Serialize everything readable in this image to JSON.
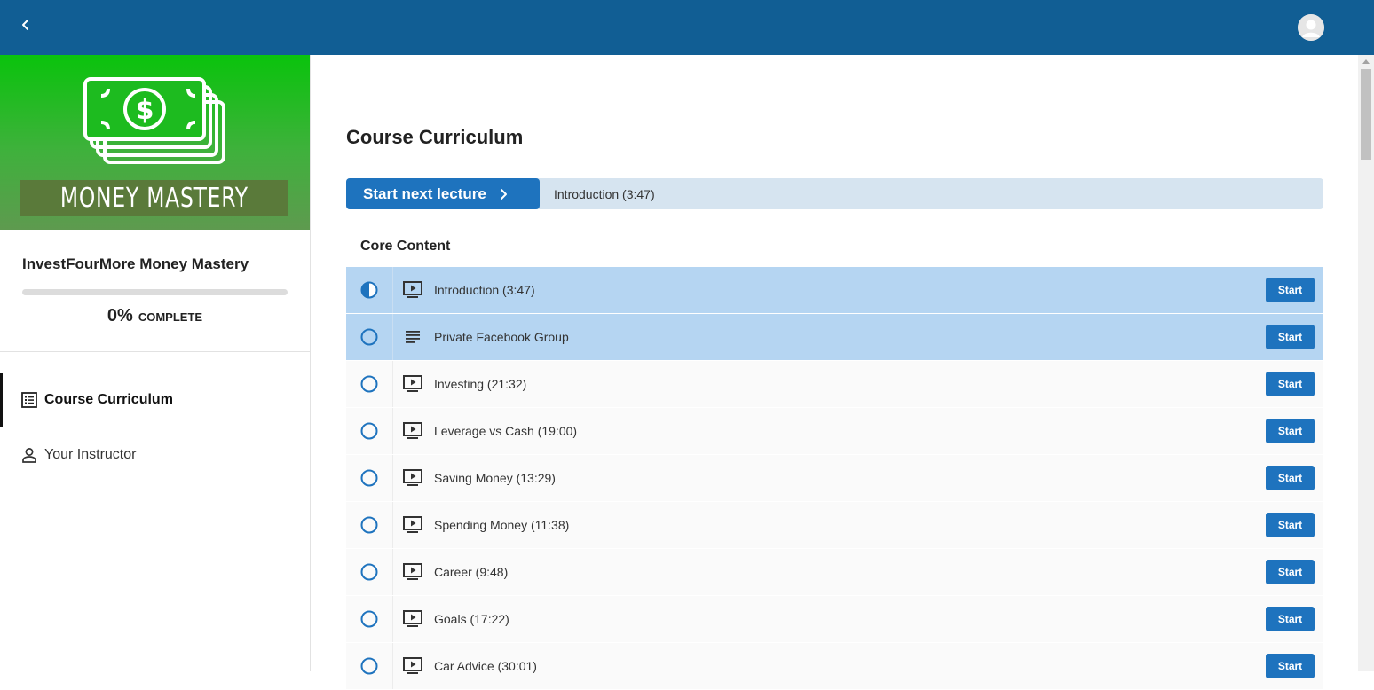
{
  "topbar": {
    "back_icon": "chevron-left-icon",
    "avatar_icon": "user-avatar-icon"
  },
  "sidebar": {
    "hero_title": "MONEY MASTERY",
    "course_name": "InvestFourMore Money Mastery",
    "progress": {
      "percent": 0,
      "percent_label": "0%",
      "complete_label": "COMPLETE"
    },
    "nav": [
      {
        "label": "Course Curriculum",
        "icon": "list-icon",
        "active": true
      },
      {
        "label": "Your Instructor",
        "icon": "person-icon",
        "active": false
      }
    ]
  },
  "main": {
    "title": "Course Curriculum",
    "next_button_label": "Start next lecture",
    "next_lecture": "Introduction (3:47)",
    "section_title": "Core Content",
    "lectures": [
      {
        "title": "Introduction (3:47)",
        "type": "video",
        "status": "in-progress",
        "highlight": true,
        "button": "Start"
      },
      {
        "title": "Private Facebook Group",
        "type": "text",
        "status": "not-started",
        "highlight": true,
        "button": "Start"
      },
      {
        "title": "Investing (21:32)",
        "type": "video",
        "status": "not-started",
        "highlight": false,
        "button": "Start"
      },
      {
        "title": "Leverage vs Cash (19:00)",
        "type": "video",
        "status": "not-started",
        "highlight": false,
        "button": "Start"
      },
      {
        "title": "Saving Money (13:29)",
        "type": "video",
        "status": "not-started",
        "highlight": false,
        "button": "Start"
      },
      {
        "title": "Spending Money (11:38)",
        "type": "video",
        "status": "not-started",
        "highlight": false,
        "button": "Start"
      },
      {
        "title": "Career (9:48)",
        "type": "video",
        "status": "not-started",
        "highlight": false,
        "button": "Start"
      },
      {
        "title": "Goals (17:22)",
        "type": "video",
        "status": "not-started",
        "highlight": false,
        "button": "Start"
      },
      {
        "title": "Car Advice (30:01)",
        "type": "video",
        "status": "not-started",
        "highlight": false,
        "button": "Start"
      }
    ]
  },
  "colors": {
    "topbar": "#115e94",
    "accent": "#1e73be",
    "highlight_row": "#b5d5f2",
    "next_bar": "#d6e4f0"
  }
}
